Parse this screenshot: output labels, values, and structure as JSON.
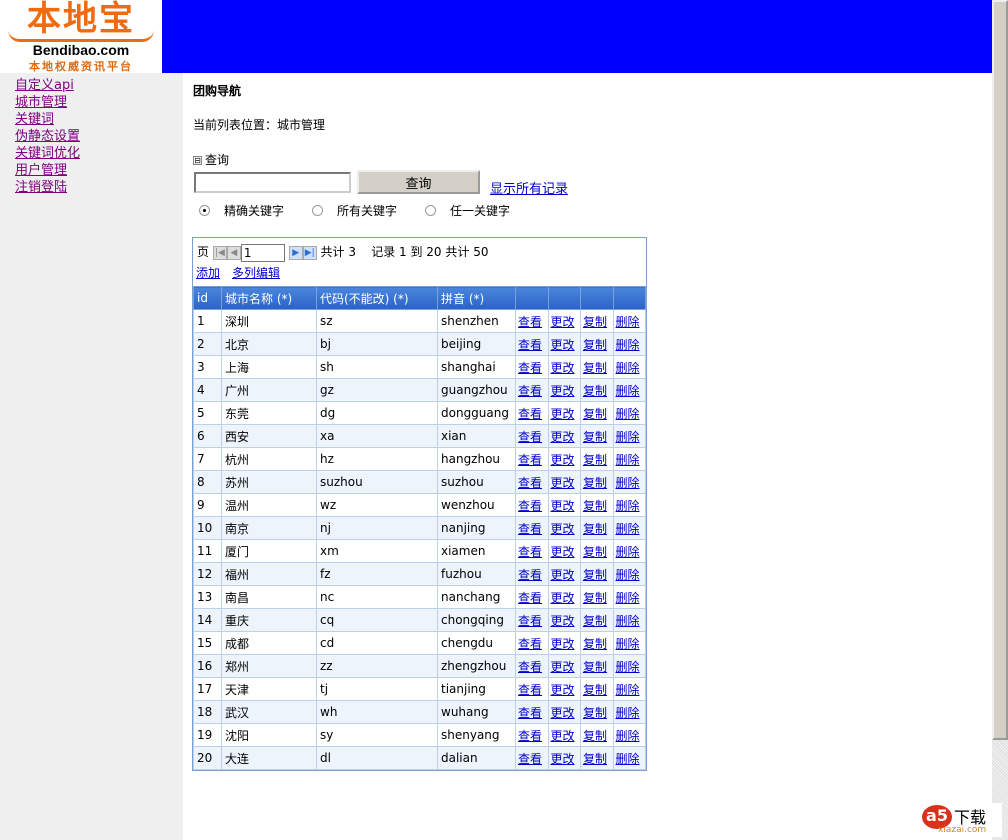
{
  "logo": {
    "cn": "本地宝",
    "en": "Bendibao.com",
    "sub": "本地权威资讯平台"
  },
  "sidebar": [
    "自定义api",
    "城市管理",
    "关键词",
    "伪静态设置",
    "关键词优化",
    "用户管理",
    "注销登陆"
  ],
  "title": "团购导航",
  "location": "当前列表位置：城市管理",
  "query": {
    "toggle": "⊟",
    "label": "查询",
    "input": "",
    "button": "查询",
    "show_all": "显示所有记录",
    "radios": [
      {
        "label": "精确关键字",
        "checked": true
      },
      {
        "label": "所有关键字",
        "checked": false
      },
      {
        "label": "任一关键字",
        "checked": false
      }
    ]
  },
  "pager": {
    "page_label": "页",
    "page": "1",
    "total_pages": "共计 3",
    "records": "记录 1 到 20 共计 50"
  },
  "grid_actions": {
    "add": "添加",
    "multi_edit": "多列编辑"
  },
  "columns": [
    "id",
    "城市名称 (*)",
    "代码(不能改) (*)",
    "拼音 (*)"
  ],
  "row_actions": [
    "查看",
    "更改",
    "复制",
    "删除"
  ],
  "rows": [
    [
      "1",
      "深圳",
      "sz",
      "shenzhen"
    ],
    [
      "2",
      "北京",
      "bj",
      "beijing"
    ],
    [
      "3",
      "上海",
      "sh",
      "shanghai"
    ],
    [
      "4",
      "广州",
      "gz",
      "guangzhou"
    ],
    [
      "5",
      "东莞",
      "dg",
      "dongguang"
    ],
    [
      "6",
      "西安",
      "xa",
      "xian"
    ],
    [
      "7",
      "杭州",
      "hz",
      "hangzhou"
    ],
    [
      "8",
      "苏州",
      "suzhou",
      "suzhou"
    ],
    [
      "9",
      "温州",
      "wz",
      "wenzhou"
    ],
    [
      "10",
      "南京",
      "nj",
      "nanjing"
    ],
    [
      "11",
      "厦门",
      "xm",
      "xiamen"
    ],
    [
      "12",
      "福州",
      "fz",
      "fuzhou"
    ],
    [
      "13",
      "南昌",
      "nc",
      "nanchang"
    ],
    [
      "14",
      "重庆",
      "cq",
      "chongqing"
    ],
    [
      "15",
      "成都",
      "cd",
      "chengdu"
    ],
    [
      "16",
      "郑州",
      "zz",
      "zhengzhou"
    ],
    [
      "17",
      "天津",
      "tj",
      "tianjing"
    ],
    [
      "18",
      "武汉",
      "wh",
      "wuhang"
    ],
    [
      "19",
      "沈阳",
      "sy",
      "shenyang"
    ],
    [
      "20",
      "大连",
      "dl",
      "dalian"
    ]
  ],
  "watermark": {
    "mark": "a5",
    "text": "下载",
    "site": "xiazai.com"
  }
}
